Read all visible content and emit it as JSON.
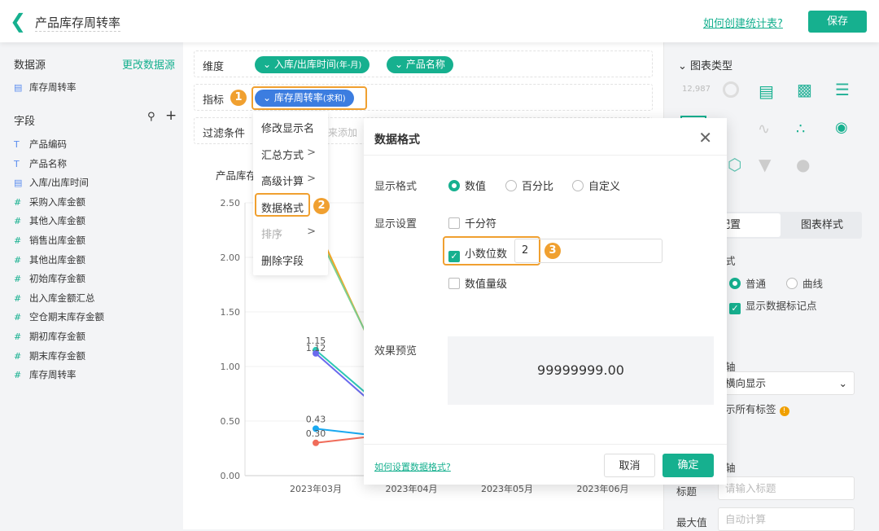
{
  "header": {
    "title": "产品库存周转率",
    "help_link": "如何创建统计表?",
    "save": "保存"
  },
  "sidebar": {
    "datasource_label": "数据源",
    "change_datasource": "更改数据源",
    "datasource": "库存周转率",
    "fields_label": "字段",
    "fields": [
      {
        "type": "T",
        "name": "产品编码"
      },
      {
        "type": "T",
        "name": "产品名称"
      },
      {
        "type": "date",
        "name": "入库/出库时间"
      },
      {
        "type": "#",
        "name": "采购入库金额"
      },
      {
        "type": "#",
        "name": "其他入库金额"
      },
      {
        "type": "#",
        "name": "销售出库金额"
      },
      {
        "type": "#",
        "name": "其他出库金额"
      },
      {
        "type": "#",
        "name": "初始库存金额"
      },
      {
        "type": "#",
        "name": "出入库金额汇总"
      },
      {
        "type": "#",
        "name": "空仓期末库存金额"
      },
      {
        "type": "#",
        "name": "期初库存金额"
      },
      {
        "type": "#",
        "name": "期末库存金额"
      },
      {
        "type": "#",
        "name": "库存周转率"
      }
    ]
  },
  "config": {
    "dimension_label": "维度",
    "dimensions": [
      {
        "name": "入库/出库时间",
        "suffix": "(年-月)"
      },
      {
        "name": "产品名称",
        "suffix": ""
      }
    ],
    "metric_label": "指标",
    "metric": {
      "name": "库存周转率",
      "suffix": "(求和)"
    },
    "filter_label": "过滤条件",
    "filter_hint": "拖拽字段至此处来添加"
  },
  "badges": [
    "1",
    "2",
    "3"
  ],
  "field_menu": [
    {
      "label": "修改显示名",
      "sub": false,
      "disabled": false
    },
    {
      "label": "汇总方式",
      "sub": true,
      "disabled": false
    },
    {
      "label": "高级计算",
      "sub": true,
      "disabled": false
    },
    {
      "label": "数据格式",
      "sub": false,
      "disabled": false
    },
    {
      "label": "排序",
      "sub": true,
      "disabled": true
    },
    {
      "label": "删除字段",
      "sub": false,
      "disabled": false
    }
  ],
  "chart_data": {
    "type": "line",
    "title": "产品库存周转率",
    "categories": [
      "2023年03月",
      "2023年04月",
      "2023年05月",
      "2023年06月"
    ],
    "ylim": [
      0,
      2.5
    ],
    "yticks": [
      "0.00",
      "0.50",
      "1.00",
      "1.50",
      "2.00",
      "2.50"
    ],
    "grid": true,
    "series": [
      {
        "color": "#f5a623",
        "values": [
          2.3,
          0.4
        ]
      },
      {
        "color": "#7ed08f",
        "values": [
          2.25,
          0.45
        ]
      },
      {
        "color": "#2ec7b5",
        "values": [
          1.15,
          0.4
        ]
      },
      {
        "color": "#6a6aee",
        "values": [
          1.12,
          0.35
        ]
      },
      {
        "color": "#1aa9f0",
        "values": [
          0.43,
          0.33
        ]
      },
      {
        "color": "#f06c5a",
        "values": [
          0.3,
          0.4
        ]
      }
    ],
    "data_labels": [
      "1.15",
      "1.12",
      "0.43",
      "0.30"
    ]
  },
  "right_panel": {
    "chart_type_label": "图表类型",
    "kpi_sample": "12,987",
    "tabs": [
      "配置",
      "图表样式"
    ],
    "line_style_label": "式",
    "line_styles": [
      "普通",
      "曲线"
    ],
    "show_markers": "显示数据标记点",
    "axis_label": "轴",
    "label_direction": "横向显示",
    "show_all_labels": "示所有标签",
    "y_axis_label": "轴",
    "title_label": "标题",
    "title_placeholder": "请输入标题",
    "max_label": "最大值",
    "max_placeholder": "自动计算"
  },
  "dialog": {
    "title": "数据格式",
    "format_label": "显示格式",
    "formats": [
      "数值",
      "百分比",
      "自定义"
    ],
    "settings_label": "显示设置",
    "thousands": "千分符",
    "decimals": "小数位数",
    "decimals_value": "2",
    "magnitude": "数值量级",
    "preview_label": "效果预览",
    "preview_value": "99999999.00",
    "help": "如何设置数据格式?",
    "cancel": "取消",
    "ok": "确定"
  }
}
